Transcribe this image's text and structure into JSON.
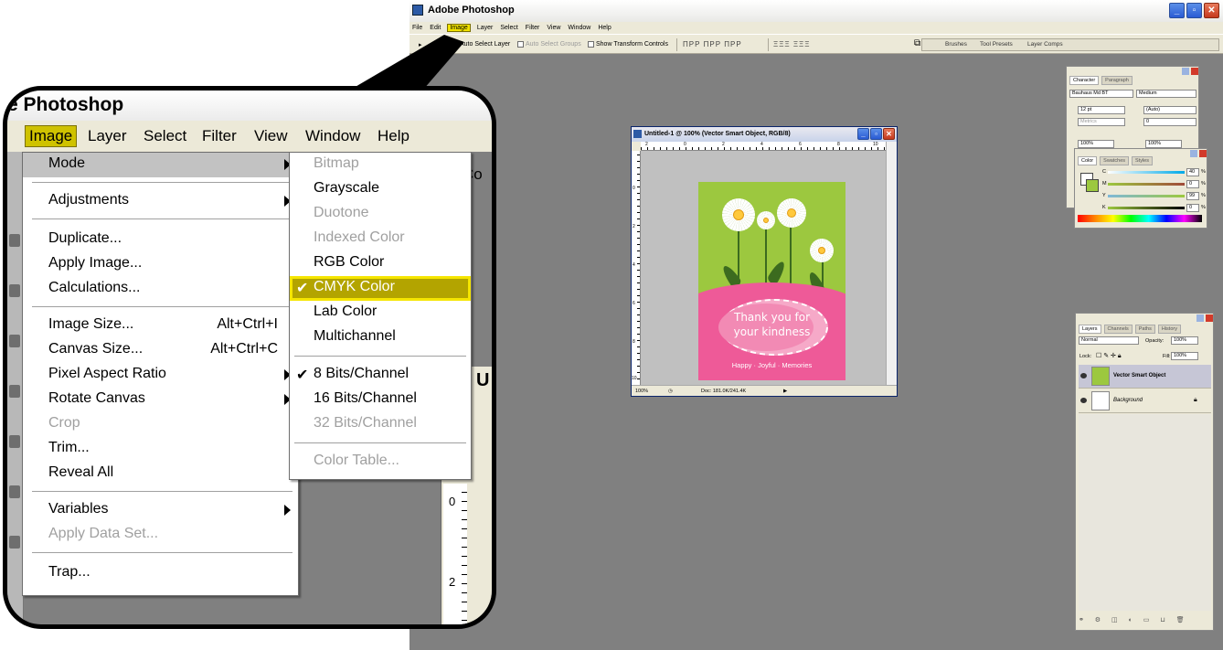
{
  "app": {
    "title": "Adobe Photoshop",
    "menu": [
      "File",
      "Edit",
      "Image",
      "Layer",
      "Select",
      "Filter",
      "View",
      "Window",
      "Help"
    ],
    "active_menu": "Image",
    "window_buttons": {
      "minimize": "_",
      "maximize": "▫",
      "close": "✕"
    }
  },
  "options_bar": {
    "auto_select_layer": "Auto Select Layer",
    "auto_select_groups": "Auto Select Groups",
    "show_transform_controls": "Show Transform Controls",
    "align_glyphs": "ПРР  ПРР  ПРР",
    "distribute_glyphs": "ΞΞΞ  ΞΞΞ",
    "well_tabs": [
      "Brushes",
      "Tool Presets",
      "Layer Comps"
    ]
  },
  "document": {
    "title": "Untitled-1 @ 100% (Vector Smart Object, RGB/8)",
    "ruler_top": [
      "2",
      "0",
      "2",
      "4",
      "6",
      "8",
      "10"
    ],
    "ruler_left": [
      "0",
      "2",
      "4",
      "6",
      "8",
      "10"
    ],
    "zoom": "100%",
    "doc_info": "Doc: 181.0K/241.4K",
    "card": {
      "message_line1": "Thank you for",
      "message_line2": "your kindness",
      "footer": "Happy · Joyful · Memories",
      "colors": {
        "green": "#9cc83f",
        "pink": "#ee5a98",
        "daisy_center": "#ffc93c"
      }
    }
  },
  "character_panel": {
    "tabs": [
      "Character",
      "Paragraph"
    ],
    "font_family": "Bauhaus Md BT",
    "font_style": "Medium",
    "font_size": "12 pt",
    "leading": "(Auto)",
    "kerning": "Metrics",
    "tracking": "0",
    "vertical_scale": "100%",
    "horizontal_scale": "100%"
  },
  "color_panel": {
    "tabs": [
      "Color",
      "Swatches",
      "Styles"
    ],
    "channels": [
      {
        "label": "C",
        "value": "40",
        "unit": "%"
      },
      {
        "label": "M",
        "value": "0",
        "unit": "%"
      },
      {
        "label": "Y",
        "value": "99",
        "unit": "%"
      },
      {
        "label": "K",
        "value": "0",
        "unit": "%"
      }
    ],
    "foreground_color": "#9cc83f"
  },
  "layers_panel": {
    "tabs": [
      "Layers",
      "Channels",
      "Paths",
      "History"
    ],
    "blend_mode": "Normal",
    "opacity_label": "Opacity:",
    "opacity": "100%",
    "lock_label": "Lock:",
    "fill_label": "Fill:",
    "fill": "100%",
    "layers": [
      {
        "name": "Vector Smart Object",
        "selected": true
      },
      {
        "name": "Background",
        "selected": false
      }
    ]
  },
  "callout": {
    "title": "e Photoshop",
    "menus": [
      "Image",
      "Layer",
      "Select",
      "Filter",
      "View",
      "Window",
      "Help"
    ],
    "options_fragment": "Co",
    "doc_fragment_letter": "U",
    "ruler_numbers": [
      "0",
      "2"
    ],
    "image_menu": {
      "mode": "Mode",
      "adjustments": "Adjustments",
      "duplicate": "Duplicate...",
      "apply_image": "Apply Image...",
      "calculations": "Calculations...",
      "image_size": "Image Size...",
      "image_size_shortcut": "Alt+Ctrl+I",
      "canvas_size": "Canvas Size...",
      "canvas_size_shortcut": "Alt+Ctrl+C",
      "pixel_aspect_ratio": "Pixel Aspect Ratio",
      "rotate_canvas": "Rotate Canvas",
      "crop": "Crop",
      "trim": "Trim...",
      "reveal_all": "Reveal All",
      "variables": "Variables",
      "apply_data_set": "Apply Data Set...",
      "trap": "Trap..."
    },
    "mode_menu": {
      "bitmap": "Bitmap",
      "grayscale": "Grayscale",
      "duotone": "Duotone",
      "indexed_color": "Indexed Color",
      "rgb_color": "RGB Color",
      "cmyk_color": "CMYK Color",
      "lab_color": "Lab Color",
      "multichannel": "Multichannel",
      "bits8": "8 Bits/Channel",
      "bits16": "16 Bits/Channel",
      "bits32": "32 Bits/Channel",
      "color_table": "Color Table...",
      "checkmark": "✔"
    }
  }
}
